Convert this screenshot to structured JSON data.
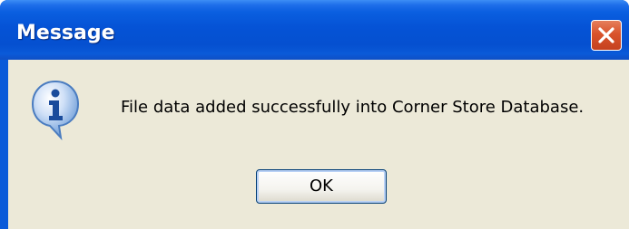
{
  "dialog": {
    "title": "Message",
    "message": "File data added successfully into Corner Store Database.",
    "icon": "info-icon",
    "ok_label": "OK",
    "close_icon": "close-icon"
  },
  "colors": {
    "titlebar": "#0553d6",
    "client": "#ece9d8",
    "close_button": "#d9532c"
  }
}
